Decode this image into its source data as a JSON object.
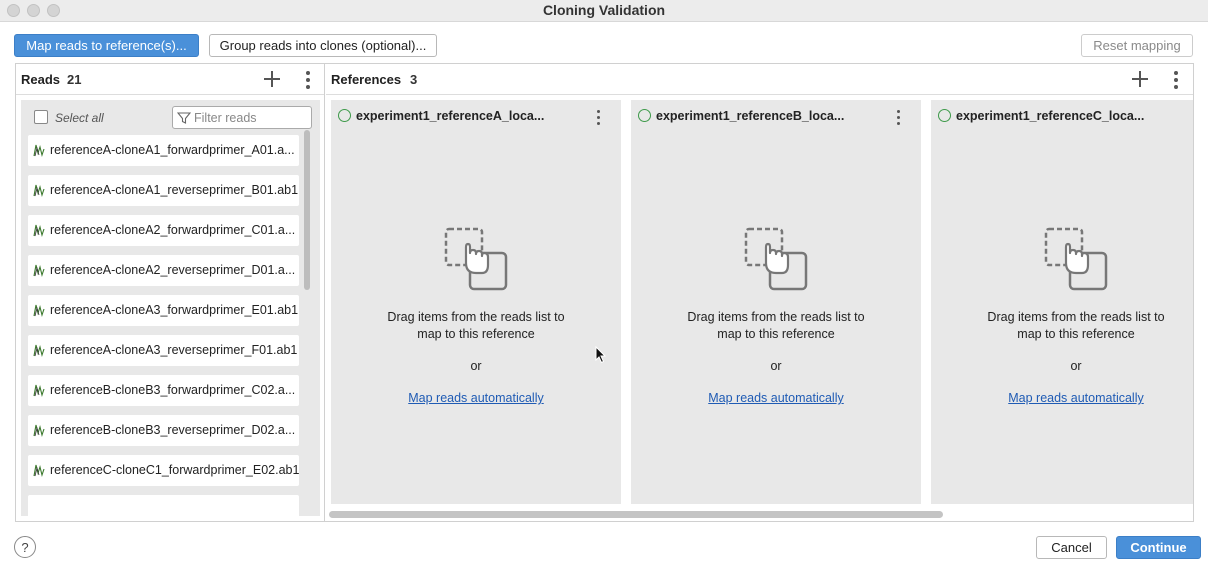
{
  "window": {
    "title": "Cloning Validation"
  },
  "toolbar": {
    "map_reads_label": "Map reads to reference(s)...",
    "group_reads_label": "Group reads into clones (optional)...",
    "reset_mapping_label": "Reset mapping"
  },
  "reads": {
    "title": "Reads",
    "count": "21",
    "select_all_label": "Select all",
    "filter_placeholder": "Filter reads",
    "items": [
      {
        "label": "referenceA-cloneA1_forwardprimer_A01.a..."
      },
      {
        "label": "referenceA-cloneA1_reverseprimer_B01.ab1"
      },
      {
        "label": "referenceA-cloneA2_forwardprimer_C01.a..."
      },
      {
        "label": "referenceA-cloneA2_reverseprimer_D01.a..."
      },
      {
        "label": "referenceA-cloneA3_forwardprimer_E01.ab1"
      },
      {
        "label": "referenceA-cloneA3_reverseprimer_F01.ab1"
      },
      {
        "label": "referenceB-cloneB3_forwardprimer_C02.a..."
      },
      {
        "label": "referenceB-cloneB3_reverseprimer_D02.a..."
      },
      {
        "label": "referenceC-cloneC1_forwardprimer_E02.ab1"
      }
    ]
  },
  "references": {
    "title": "References",
    "count": "3",
    "items": [
      {
        "name": "experiment1_referenceA_loca...",
        "drag_line1": "Drag items from the reads list to",
        "drag_line2": "map to this reference",
        "or_label": "or",
        "map_link": "Map reads automatically"
      },
      {
        "name": "experiment1_referenceB_loca...",
        "drag_line1": "Drag items from the reads list to",
        "drag_line2": "map to this reference",
        "or_label": "or",
        "map_link": "Map reads automatically"
      },
      {
        "name": "experiment1_referenceC_loca...",
        "drag_line1": "Drag items from the reads list to",
        "drag_line2": "map to this reference",
        "or_label": "or",
        "map_link": "Map reads automatically"
      }
    ]
  },
  "footer": {
    "help_label": "?",
    "cancel_label": "Cancel",
    "continue_label": "Continue"
  },
  "colors": {
    "primary": "#4a90d9",
    "link": "#1f5bb4",
    "status_ring": "#3e9a4a"
  },
  "icons": [
    "plus-icon",
    "kebab-menu-icon",
    "filter-icon",
    "read-trace-icon",
    "drag-drop-icon",
    "status-circle-icon",
    "help-icon"
  ]
}
